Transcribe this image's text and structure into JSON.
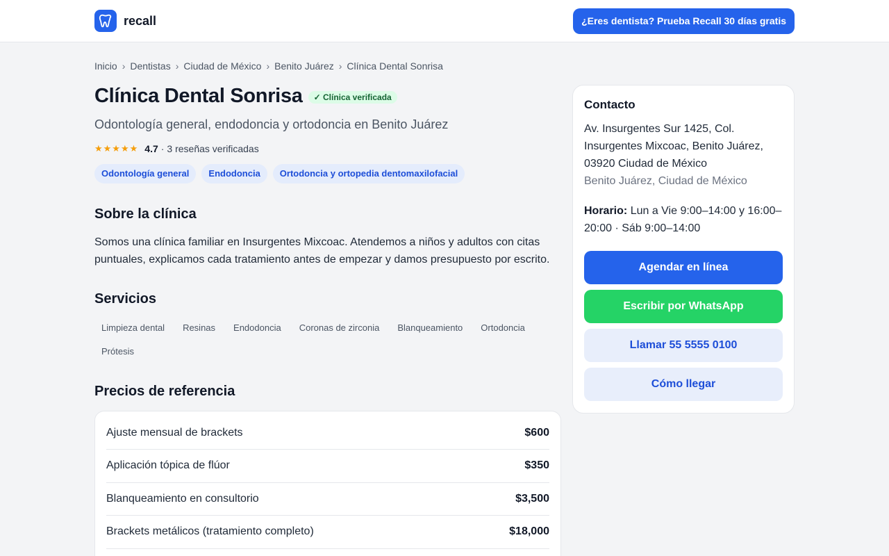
{
  "header": {
    "brand": "recall",
    "cta": "¿Eres dentista? Prueba Recall 30 días gratis"
  },
  "breadcrumb": [
    "Inicio",
    "Dentistas",
    "Ciudad de México",
    "Benito Juárez",
    "Clínica Dental Sonrisa"
  ],
  "clinic": {
    "name": "Clínica Dental Sonrisa",
    "verified_badge": "✓ Clínica verificada",
    "subtitle": "Odontología general, endodoncia y ortodoncia en Benito Juárez",
    "stars": "★★★★★",
    "rating": "4.7",
    "reviews": "3 reseñas verificadas",
    "specialties": [
      "Odontología general",
      "Endodoncia",
      "Ortodoncia y ortopedia dentomaxilofacial"
    ]
  },
  "about": {
    "title": "Sobre la clínica",
    "text": "Somos una clínica familiar en Insurgentes Mixcoac. Atendemos a niños y adultos con citas puntuales, explicamos cada tratamiento antes de empezar y damos presupuesto por escrito."
  },
  "services": {
    "title": "Servicios",
    "items": [
      "Limpieza dental",
      "Resinas",
      "Endodoncia",
      "Coronas de zirconia",
      "Blanqueamiento",
      "Ortodoncia",
      "Prótesis"
    ]
  },
  "prices": {
    "title": "Precios de referencia",
    "rows": [
      {
        "name": "Ajuste mensual de brackets",
        "price": "$600"
      },
      {
        "name": "Aplicación tópica de flúor",
        "price": "$350"
      },
      {
        "name": "Blanqueamiento en consultorio",
        "price": "$3,500"
      },
      {
        "name": "Brackets metálicos (tratamiento completo)",
        "price": "$18,000"
      }
    ]
  },
  "contact": {
    "title": "Contacto",
    "address": "Av. Insurgentes Sur 1425, Col. Insurgentes Mixcoac, Benito Juárez, 03920 Ciudad de México",
    "area": "Benito Juárez, Ciudad de México",
    "hours_label": "Horario:",
    "hours": "Lun a Vie 9:00–14:00 y 16:00–20:00 · Sáb 9:00–14:00",
    "book": "Agendar en línea",
    "whatsapp": "Escribir por WhatsApp",
    "call": "Llamar 55 5555 0100",
    "directions": "Cómo llegar"
  },
  "colors": {
    "primary": "#2563eb",
    "whatsapp": "#25d366",
    "verified_bg": "#dcfce7",
    "star": "#f59e0b"
  },
  "icons": {
    "logo": "tooth-icon"
  }
}
